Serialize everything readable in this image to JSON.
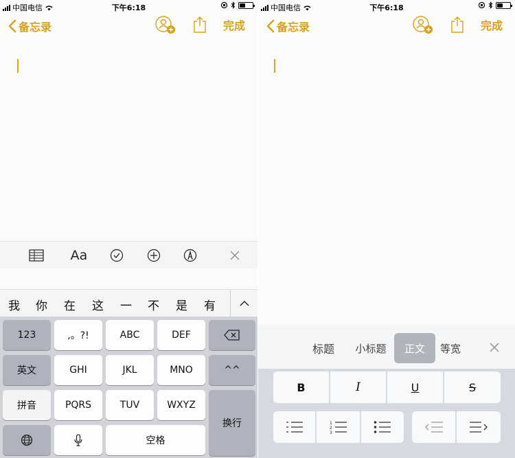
{
  "status": {
    "carrier": "中国电信",
    "time": "下午6:18"
  },
  "nav": {
    "back_label": "备忘录",
    "done_label": "完成"
  },
  "toolbar": {
    "aa_label": "Aa",
    "icons": [
      "table-icon",
      "text-format-icon",
      "checklist-icon",
      "add-icon",
      "markup-icon",
      "close-icon"
    ]
  },
  "candidates": [
    "我",
    "你",
    "在",
    "这",
    "一",
    "不",
    "是",
    "有"
  ],
  "keyboard": {
    "k123": "123",
    "punct": ",。?!",
    "abc": "ABC",
    "def": "DEF",
    "english": "英文",
    "ghi": "GHI",
    "jkl": "JKL",
    "mno": "MNO",
    "emoticon": "^^",
    "pinyin": "拼音",
    "pqrs": "PQRS",
    "tuv": "TUV",
    "wxyz": "WXYZ",
    "return": "换行",
    "space": "空格"
  },
  "format_panel": {
    "styles": [
      "标题",
      "小标题",
      "正文",
      "等宽"
    ],
    "selected_style": "正文",
    "bold": "B",
    "italic": "I",
    "underline": "U",
    "strike": "S"
  },
  "colors": {
    "accent": "#d7a11c",
    "keyboard_bg": "#d1d3d9",
    "key_dark": "#aeb3bd"
  }
}
